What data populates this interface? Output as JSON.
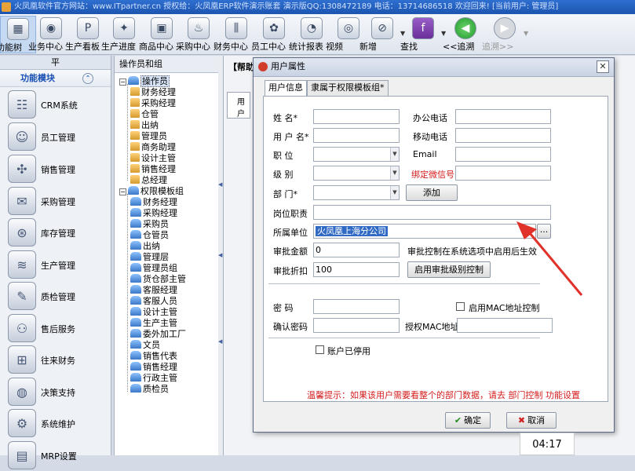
{
  "window": {
    "title": "火凤凰软件官方网站：www.ITpartner.cn  授权给：火凤凰ERP软件演示账套 演示版QQ:1308472189  电话：13714686518  欢迎回来! [当前用户: 管理员]"
  },
  "toolbar": {
    "items": [
      {
        "label": "功能树",
        "icon": "tree-icon"
      },
      {
        "label": "业务中心",
        "icon": "business-icon"
      },
      {
        "label": "生产看板",
        "icon": "board-icon"
      },
      {
        "label": "生产进度",
        "icon": "progress-icon"
      },
      {
        "label": "商品中心",
        "icon": "goods-icon"
      },
      {
        "label": "采购中心",
        "icon": "purchase-icon"
      },
      {
        "label": "财务中心",
        "icon": "finance-icon"
      },
      {
        "label": "员工中心",
        "icon": "staff-icon"
      },
      {
        "label": "统计报表",
        "icon": "report-icon"
      },
      {
        "label": "视频",
        "icon": "video-icon"
      },
      {
        "label": "新增",
        "icon": "new-icon"
      },
      {
        "label": "查找",
        "icon": "find-icon"
      },
      {
        "label": "<<追溯",
        "icon": "back-arrow-icon"
      },
      {
        "label": "追溯>>",
        "icon": "forward-arrow-icon"
      }
    ]
  },
  "left_panel": {
    "header": "平",
    "module_title": "功能模块",
    "modules": [
      "CRM系统",
      "员工管理",
      "销售管理",
      "采购管理",
      "库存管理",
      "生产管理",
      "质检管理",
      "售后服务",
      "往来财务",
      "决策支持",
      "系统维护",
      "MRP设置"
    ]
  },
  "tree_panel": {
    "header": "操作员和组",
    "operators_label": "操作员",
    "operators": [
      "财务经理",
      "采购经理",
      "仓管",
      "出纳",
      "管理员",
      "商务助理",
      "设计主管",
      "销售经理",
      "总经理"
    ],
    "groups_label": "权限模板组",
    "groups": [
      "财务经理",
      "采购经理",
      "采购员",
      "仓管员",
      "出纳",
      "管理层",
      "管理员组",
      "货仓部主管",
      "客服经理",
      "客服人员",
      "设计主管",
      "生产主管",
      "委外加工厂",
      "文员",
      "销售代表",
      "销售经理",
      "行政主管",
      "质检员"
    ]
  },
  "right_area": {
    "header": "【帮助",
    "grid_col": "用户"
  },
  "dialog": {
    "title": "用户属性",
    "tabs": [
      "用户信息",
      "隶属于权限模板组*"
    ],
    "fields": {
      "name_label": "姓    名*",
      "username_label": "用 户 名*",
      "position_label": "职    位",
      "level_label": "级    别",
      "dept_label": "部    门*",
      "office_phone_label": "办公电话",
      "mobile_label": "移动电话",
      "email_label": "Email",
      "wechat_label": "绑定微信号",
      "duty_label": "岗位职责",
      "unit_label": "所属单位",
      "unit_value": "火凤凰上海分公司",
      "approve_amount_label": "审批金额",
      "approve_amount_value": "0",
      "approve_discount_label": "审批折扣",
      "approve_discount_value": "100",
      "approve_note": "审批控制在系统选项中启用后生效",
      "password_label": "密    码",
      "confirm_password_label": "确认密码",
      "mac_control_label": "启用MAC地址控制",
      "mac_addr_label": "授权MAC地址",
      "disabled_label": "账户已停用"
    },
    "add_button": "添加",
    "enable_approve_button": "启用审批级别控制",
    "browse_button": "...",
    "hint": "温馨提示：如果该用户需要看整个的部门数据，请去 部门控制 功能设置",
    "ok_button": "确定",
    "cancel_button": "取消"
  },
  "clock": {
    "time": "04:17"
  },
  "colors": {
    "hint": "#d41c1c",
    "selection": "#316ac5",
    "arrow": "#e0322b"
  }
}
